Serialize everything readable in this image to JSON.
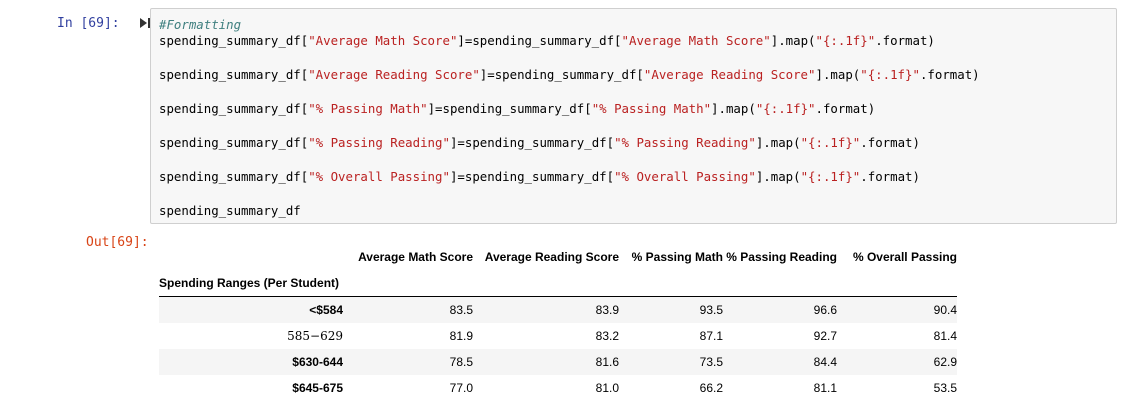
{
  "cell": {
    "in_prompt": "In [69]:",
    "out_prompt": "Out[69]:",
    "comment": "#Formatting",
    "lines": [
      [
        "spending_summary_df[",
        "\"Average Math Score\"",
        "]=spending_summary_df[",
        "\"Average Math Score\"",
        "].map(",
        "\"{:.1f}\"",
        ".format)"
      ],
      [
        "spending_summary_df[",
        "\"Average Reading Score\"",
        "]=spending_summary_df[",
        "\"Average Reading Score\"",
        "].map(",
        "\"{:.1f}\"",
        ".format)"
      ],
      [
        "spending_summary_df[",
        "\"% Passing Math\"",
        "]=spending_summary_df[",
        "\"% Passing Math\"",
        "].map(",
        "\"{:.1f}\"",
        ".format)"
      ],
      [
        "spending_summary_df[",
        "\"% Passing Reading\"",
        "]=spending_summary_df[",
        "\"% Passing Reading\"",
        "].map(",
        "\"{:.1f}\"",
        ".format)"
      ],
      [
        "spending_summary_df[",
        "\"% Overall Passing\"",
        "]=spending_summary_df[",
        "\"% Overall Passing\"",
        "].map(",
        "\"{:.1f}\"",
        ".format)"
      ]
    ],
    "last_line": "spending_summary_df"
  },
  "table": {
    "index_name": "Spending Ranges (Per Student)",
    "columns": [
      "Average Math Score",
      "Average Reading Score",
      "% Passing Math",
      "% Passing Reading",
      "% Overall Passing"
    ],
    "rows": [
      {
        "label": "<$584",
        "values": [
          "83.5",
          "83.9",
          "93.5",
          "96.6",
          "90.4"
        ]
      },
      {
        "label": "585−629",
        "values": [
          "81.9",
          "83.2",
          "87.1",
          "92.7",
          "81.4"
        ]
      },
      {
        "label": "$630-644",
        "values": [
          "78.5",
          "81.6",
          "73.5",
          "84.4",
          "62.9"
        ]
      },
      {
        "label": "$645-675",
        "values": [
          "77.0",
          "81.0",
          "66.2",
          "81.1",
          "53.5"
        ]
      }
    ]
  },
  "colors": {
    "in_prompt": "#303f9f",
    "out_prompt": "#d84315",
    "string": "#ba2121",
    "comment": "#408080"
  },
  "icons": {
    "run": "run-cell-icon"
  }
}
